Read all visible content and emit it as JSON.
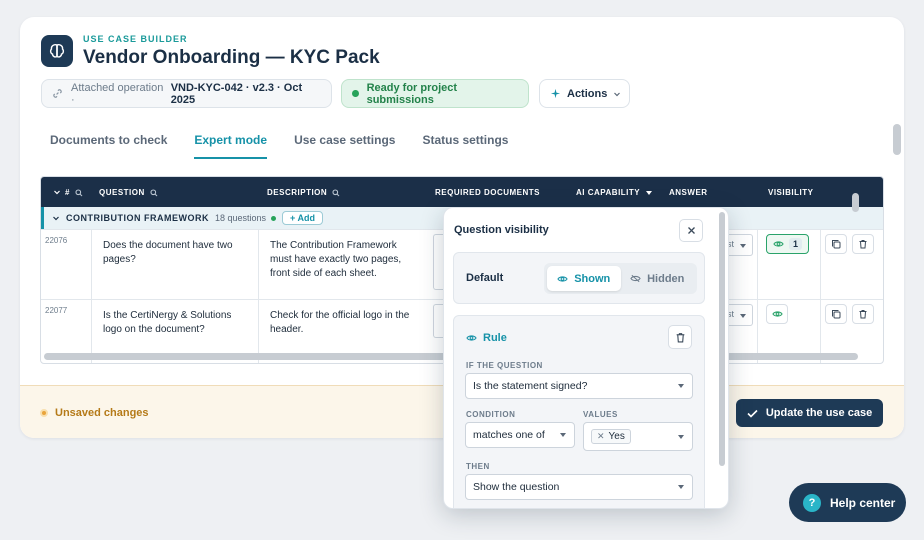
{
  "header": {
    "eyebrow": "USE CASE BUILDER",
    "title": "Vendor Onboarding — KYC Pack",
    "attached_label": "Attached operation ·",
    "attached_value": "VND-KYC-042 · v2.3 · Oct 2025",
    "status": "Ready for project submissions",
    "actions_label": "Actions"
  },
  "tabs": [
    {
      "label": "Documents to check",
      "active": false
    },
    {
      "label": "Expert mode",
      "active": true
    },
    {
      "label": "Use case settings",
      "active": false
    },
    {
      "label": "Status settings",
      "active": false
    }
  ],
  "table": {
    "columns": {
      "num": "#",
      "question": "QUESTION",
      "description": "DESCRIPTION",
      "required_docs": "REQUIRED DOCUMENTS",
      "ai_capability": "AI CAPABILITY",
      "answer": "ANSWER",
      "visibility": "VISIBILITY"
    },
    "group": {
      "name": "CONTRIBUTION FRAMEWORK",
      "count": "18 questions",
      "add_label": "+ Add"
    },
    "rows": [
      {
        "id": "22076",
        "question": "Does the document have two pages?",
        "description": "The Contribution Framework must have exactly two pages, front side of each sheet.",
        "answer_frag": "st",
        "visibility_count": "1"
      },
      {
        "id": "22077",
        "question": "Is the CertiNergy & Solutions logo on the document?",
        "description": "Check for the official logo in the header.",
        "answer_frag": "st"
      }
    ]
  },
  "footer": {
    "unsaved": "Unsaved changes",
    "update_label": "Update the use case"
  },
  "popover": {
    "title": "Question visibility",
    "default_label": "Default",
    "shown_label": "Shown",
    "hidden_label": "Hidden",
    "default_selected": "Shown",
    "rule": {
      "title": "Rule",
      "if_label": "IF THE QUESTION",
      "if_value": "Is the statement signed?",
      "condition_label": "CONDITION",
      "condition_value": "matches one of",
      "values_label": "VALUES",
      "values": [
        "Yes"
      ],
      "then_label": "THEN",
      "then_value": "Show the question"
    }
  },
  "help": {
    "label": "Help center"
  },
  "colors": {
    "accent": "#1692a8",
    "navy": "#1e3a56",
    "success": "#27a35a",
    "warning": "#e9a43c"
  }
}
